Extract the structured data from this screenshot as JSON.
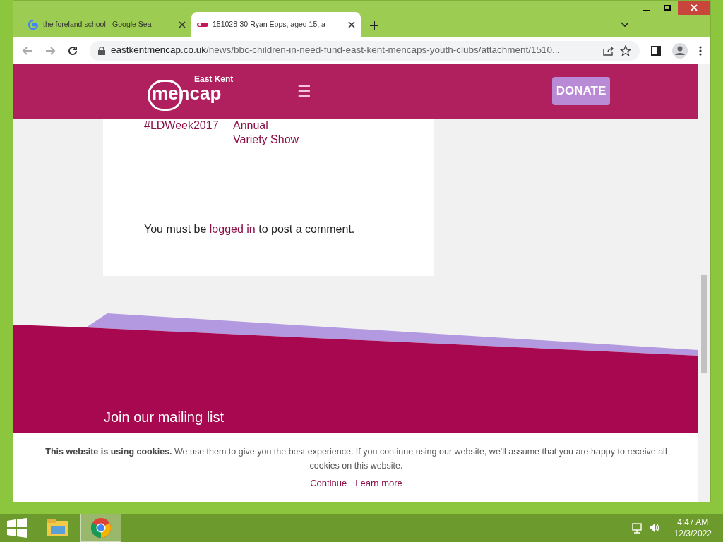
{
  "browser": {
    "tabs": [
      {
        "title": "the foreland school - Google Sea",
        "kind": "google",
        "selected": false
      },
      {
        "title": "151028-30 Ryan Epps, aged 15, a",
        "kind": "site",
        "selected": true
      }
    ],
    "url_domain": "eastkentmencap.co.uk",
    "url_path": "/news/bbc-children-in-need-fund-east-kent-mencaps-youth-clubs/attachment/1510..."
  },
  "header": {
    "logo_small": "East Kent",
    "logo_main": "mencap",
    "menu_glyph": "☰",
    "donate": "DONATE"
  },
  "related_posts": [
    {
      "lines": [
        "#LDWeek2017"
      ]
    },
    {
      "lines": [
        "Annual",
        "Variety Show"
      ]
    }
  ],
  "comment_notice": {
    "before": "You must be ",
    "link": "logged in",
    "after": " to post a comment."
  },
  "footer": {
    "heading": "Join our mailing list"
  },
  "cookie_banner": {
    "text": "**This website is using cookies.** We use them to give you the best experience. If you continue using our website, we'll assume that you are happy to receive all cookies on this website.",
    "actions": [
      "Continue",
      "Learn more"
    ]
  },
  "taskbar": {
    "apps": [
      {
        "kind": "explorer",
        "selected": false
      },
      {
        "kind": "chrome",
        "selected": true
      }
    ],
    "time": "4:47 AM",
    "date": "12/3/2022"
  }
}
